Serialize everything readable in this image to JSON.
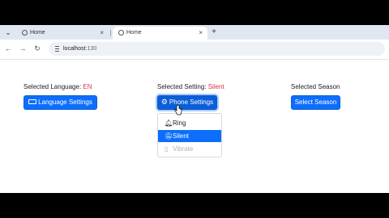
{
  "browser": {
    "tabs": [
      {
        "title": "Home",
        "active": false
      },
      {
        "title": "Home",
        "active": true
      }
    ],
    "url_host": "localhost",
    "url_port": ":130",
    "new_tab_glyph": "+",
    "close_glyph": "×"
  },
  "page": {
    "language": {
      "label": "Selected Language: ",
      "value": "EN",
      "button": "Language Settings",
      "icon": "keyboard-icon"
    },
    "setting": {
      "label": "Selected Setting: ",
      "value": "Silent",
      "button": "Phone Settings",
      "icon": "gear-icon"
    },
    "season": {
      "label": "Selected Season",
      "button": "Select Season"
    },
    "dropdown": {
      "items": [
        {
          "label": "Ring",
          "icon": "bell-icon",
          "state": "normal"
        },
        {
          "label": "Silent",
          "icon": "bell-slash-icon",
          "state": "active"
        },
        {
          "label": "Vibrate",
          "icon": "vibrate-icon",
          "state": "disabled"
        }
      ]
    }
  },
  "colors": {
    "primary": "#0d6efd",
    "danger": "#dc3545",
    "tabstrip": "#dfe7f3"
  }
}
